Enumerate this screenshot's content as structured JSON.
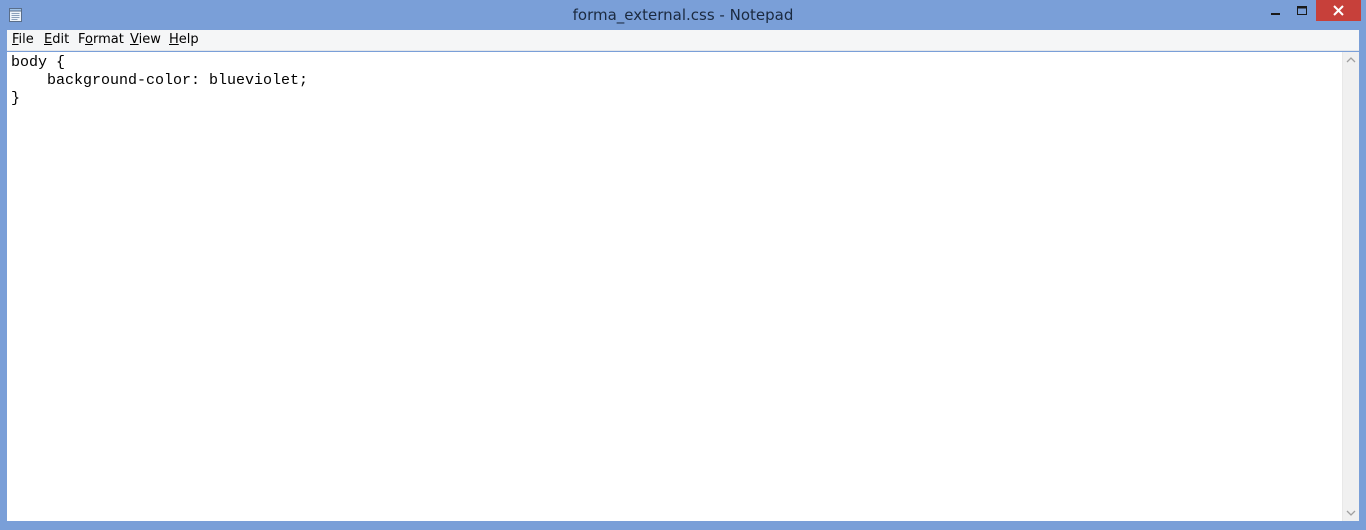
{
  "window": {
    "title": "forma_external.css - Notepad",
    "accent_color": "#7a9fd8",
    "close_color": "#c7403a"
  },
  "controls": {
    "minimize_icon": "minimize-icon",
    "maximize_icon": "maximize-icon",
    "close_icon": "close-icon"
  },
  "menu": {
    "items": [
      {
        "label": "File",
        "mnemonic": "F",
        "rest": "ile"
      },
      {
        "label": "Edit",
        "mnemonic": "E",
        "rest": "dit"
      },
      {
        "label": "Format",
        "mnemonic": "o",
        "pre": "F",
        "rest": "rmat"
      },
      {
        "label": "View",
        "mnemonic": "V",
        "rest": "iew"
      },
      {
        "label": "Help",
        "mnemonic": "H",
        "rest": "elp"
      }
    ]
  },
  "editor": {
    "content": "body {\n    background-color: blueviolet;\n}"
  },
  "scrollbar": {
    "up_icon": "scroll-up-arrow-icon",
    "down_icon": "scroll-down-arrow-icon"
  }
}
